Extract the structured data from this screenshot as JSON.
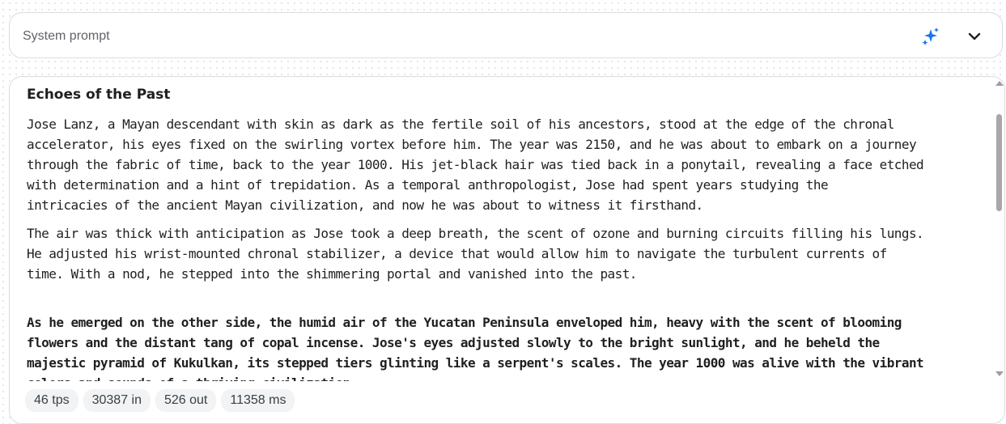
{
  "system_prompt": {
    "placeholder": "System prompt",
    "sparkle_icon": "sparkle-icon",
    "toggle_icon": "chevron-down-icon",
    "accent": "#1a73e8"
  },
  "response": {
    "title": "Echoes of the Past",
    "paragraphs": [
      {
        "lines": [
          "Jose Lanz, a Mayan descendant with skin as dark as the fertile soil of his ancestors, stood at the edge of the chronal",
          "accelerator, his eyes fixed on the swirling vortex before him. The year was 2150, and he was about to embark on a journey",
          "through the fabric of time, back to the year 1000. His jet-black hair was tied back in a ponytail, revealing a face etched",
          "with determination and a hint of trepidation. As a temporal anthropologist, Jose had spent years studying the",
          "intricacies of the ancient Mayan civilization, and now he was about to witness it firsthand."
        ]
      },
      {
        "lines": [
          "The air was thick with anticipation as Jose took a deep breath, the scent of ozone and burning circuits filling his lungs.",
          "He adjusted his wrist-mounted chronal stabilizer, a device that would allow him to navigate the turbulent currents of",
          "time. With a nod, he stepped into the shimmering portal and vanished into the past."
        ]
      },
      {
        "lines": [
          "As he emerged on the other side, the humid air of the Yucatan Peninsula enveloped him, heavy with the scent of blooming",
          "flowers and the distant tang of copal incense. Jose's eyes adjusted slowly to the bright sunlight, and he beheld the",
          "majestic pyramid of Kukulkan, its stepped tiers glinting like a serpent's scales. The year 1000 was alive with the vibrant",
          "colors and sounds of a thriving civilization."
        ]
      }
    ],
    "stats": {
      "tps": "46 tps",
      "tokens_in": "30387 in",
      "tokens_out": "526 out",
      "latency": "11358 ms"
    }
  },
  "colors": {
    "text": "#1f1f1f",
    "border": "#dadce0",
    "chip_bg": "#f1f3f4"
  }
}
